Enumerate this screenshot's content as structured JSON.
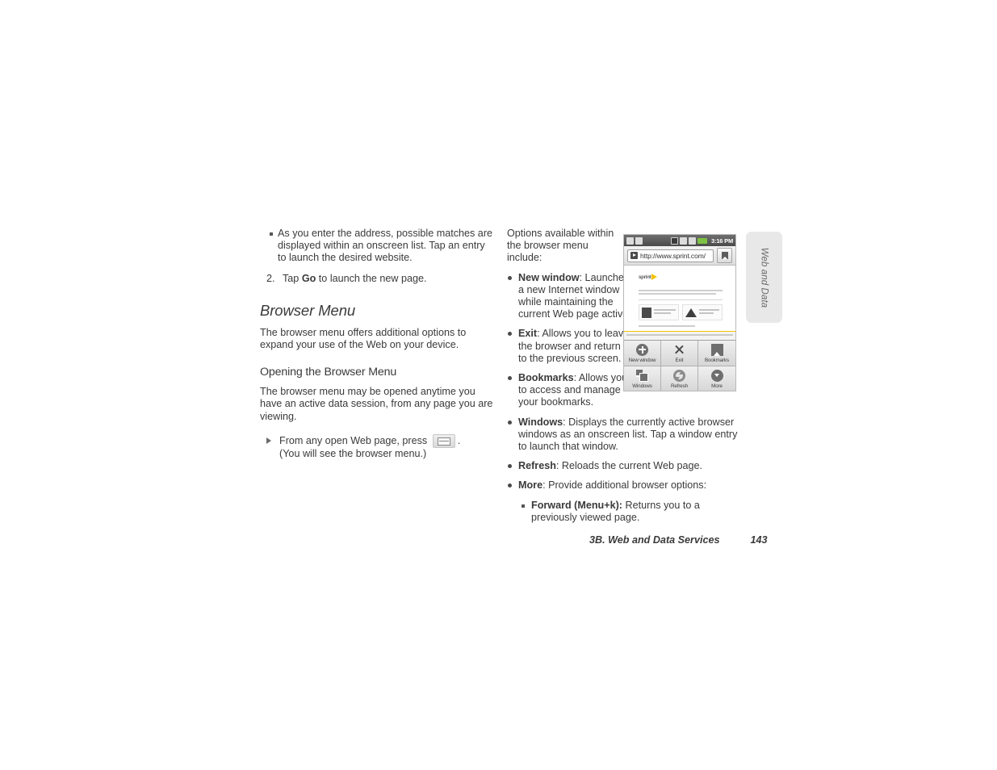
{
  "left_column": {
    "bullet_item": "As you enter the address, possible matches are displayed within an onscreen list. Tap an entry to launch the desired website.",
    "numbered_item": {
      "number": "2.",
      "text_before": "Tap ",
      "bold": "Go",
      "text_after": " to launch the new page."
    },
    "section_title": "Browser Menu",
    "section_paragraph": "The browser menu offers additional options to expand your use of the Web on your device.",
    "sub_title": "Opening the Browser Menu",
    "sub_paragraph": "The browser menu may be opened anytime you have an active data session, from any page you are viewing.",
    "step": {
      "text_before": "From any open Web page, press",
      "icon_name": "menu-key-icon",
      "text_after": ".",
      "note": "(You will see the browser menu.)"
    }
  },
  "right_column": {
    "intro": "Options available within the browser menu include:",
    "items": [
      {
        "term": "New window",
        "desc": ": Launches a new Internet window while maintaining the current Web page active.",
        "narrow": true
      },
      {
        "term": "Exit",
        "desc": ": Allows you to leave the browser and return to the previous screen.",
        "narrow": true
      },
      {
        "term": "Bookmarks",
        "desc": ": Allows you to access and manage your bookmarks.",
        "narrow": true
      },
      {
        "term": "Windows",
        "desc": ": Displays the currently active browser windows as an onscreen list. Tap a window entry to launch that window.",
        "narrow": false
      },
      {
        "term": "Refresh",
        "desc": ": Reloads the current Web page.",
        "narrow": false
      },
      {
        "term": "More",
        "desc": ": Provide additional browser options:",
        "narrow": false
      }
    ],
    "sub_item": {
      "term": "Forward (Menu+k):",
      "desc": " Returns you to a previously viewed page."
    }
  },
  "phone_screenshot": {
    "status_bar": {
      "left_icons": [
        "messaging-icon",
        "download-icon"
      ],
      "right_icons": [
        "bluetooth-icon",
        "network-icon",
        "signal-icon",
        "battery-icon"
      ],
      "time": "3:16 PM"
    },
    "url_bar": {
      "go_icon": "go-arrow-icon",
      "url": "http://www.sprint.com/",
      "bookmark_icon": "bookmark-star-icon"
    },
    "webpage": {
      "logo_text": "sprint"
    },
    "menu_grid": [
      {
        "icon": "plus-circle-icon",
        "label": "New window"
      },
      {
        "icon": "close-x-icon",
        "label": "Exit"
      },
      {
        "icon": "bookmark-star-icon",
        "label": "Bookmarks"
      },
      {
        "icon": "windows-stack-icon",
        "label": "Windows"
      },
      {
        "icon": "refresh-icon",
        "label": "Refresh"
      },
      {
        "icon": "more-chevron-icon",
        "label": "More"
      }
    ]
  },
  "side_tab": {
    "label": "Web and Data"
  },
  "footer": {
    "title": "3B. Web and Data Services",
    "page_number": "143"
  },
  "colors": {
    "accent_yellow": "#f6c300",
    "battery_green": "#7dc242",
    "side_tab_bg": "#e8e8e8",
    "text": "#3a3a3a"
  }
}
